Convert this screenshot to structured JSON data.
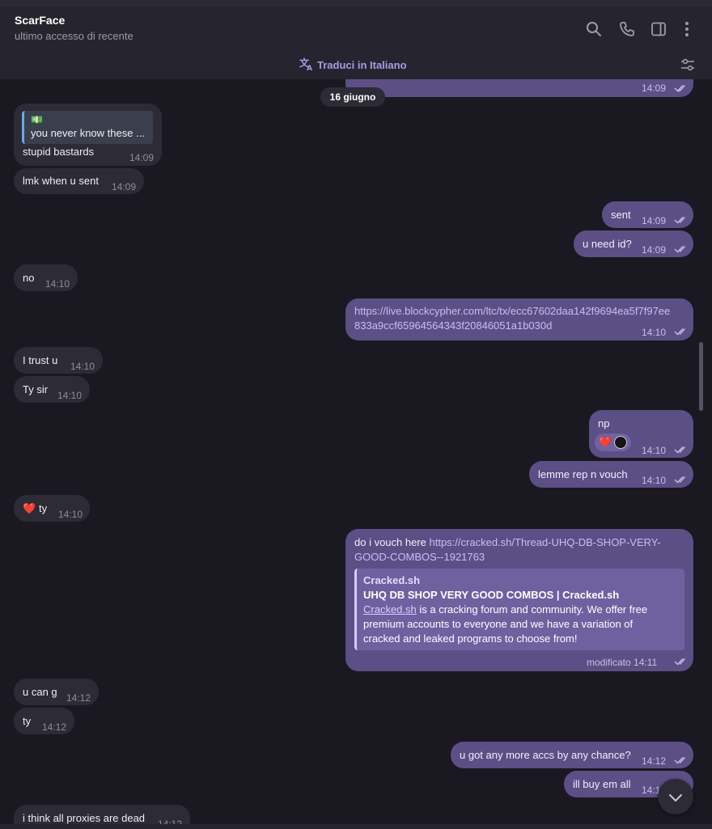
{
  "header": {
    "contact_name": "ScarFace",
    "status": "ultimo accesso di recente",
    "icons": [
      "search-icon",
      "phone-icon",
      "sidebar-icon",
      "more-icon"
    ]
  },
  "translate_bar": {
    "label": "Traduci in Italiano",
    "icons": [
      "translate-icon",
      "filter-icon"
    ]
  },
  "date_separator": "16 giugno",
  "messages": [
    {
      "dir": "out",
      "text": "",
      "time": "14:09"
    },
    {
      "dir": "in",
      "reply_emoji": "💵",
      "reply_text": "you never know these ...",
      "text": "stupid bastards",
      "time": "14:09"
    },
    {
      "dir": "in",
      "text": "lmk when u sent",
      "time": "14:09"
    },
    {
      "dir": "out",
      "text": "sent",
      "time": "14:09"
    },
    {
      "dir": "out",
      "text": "u need id?",
      "time": "14:09"
    },
    {
      "dir": "in",
      "text": "no",
      "time": "14:10"
    },
    {
      "dir": "out",
      "line1": "https://live.blockcypher.com/ltc/tx/ecc67602daa142f9694ea5f7f97ee",
      "line2": "833a9ccf65964564343f20846051a1b030d",
      "time": "14:10"
    },
    {
      "dir": "in",
      "text": "I trust u",
      "time": "14:10"
    },
    {
      "dir": "in",
      "text": "Ty sir",
      "time": "14:10"
    },
    {
      "dir": "out",
      "text": "np",
      "reaction": "❤️",
      "time": "14:10"
    },
    {
      "dir": "out",
      "text": "lemme rep n vouch",
      "time": "14:10"
    },
    {
      "dir": "in",
      "emoji": "❤️",
      "text": "ty",
      "time": "14:10"
    },
    {
      "dir": "out",
      "prefix": "do i vouch here ",
      "link1": "https://cracked.sh/Thread-UHQ-DB-SHOP-VERY-",
      "link2": "GOOD-COMBOS--1921763",
      "preview": {
        "site": "Cracked.sh",
        "title": "UHQ DB SHOP VERY GOOD COMBOS | Cracked.sh",
        "desc_link": "Cracked.sh",
        "desc_1": " is a cracking forum and community. We offer free",
        "desc_2": "premium accounts to everyone and we have a variation of",
        "desc_3": "cracked and leaked programs to choose from!"
      },
      "time": "modificato 14:11"
    },
    {
      "dir": "in",
      "text": "u can g",
      "time": "14:12"
    },
    {
      "dir": "in",
      "text": "ty",
      "time": "14:12"
    },
    {
      "dir": "out",
      "text": "u got any more accs by any chance?",
      "time": "14:12"
    },
    {
      "dir": "out",
      "text": "ill buy em all",
      "time": "14:1"
    },
    {
      "dir": "in",
      "text": "i think all proxies are dead",
      "time": "14:12"
    }
  ],
  "colors": {
    "incoming_bubble": "#2c2b36",
    "outgoing_bubble": "#5b4f85",
    "accent": "#a99be4",
    "background": "#1a1821"
  }
}
